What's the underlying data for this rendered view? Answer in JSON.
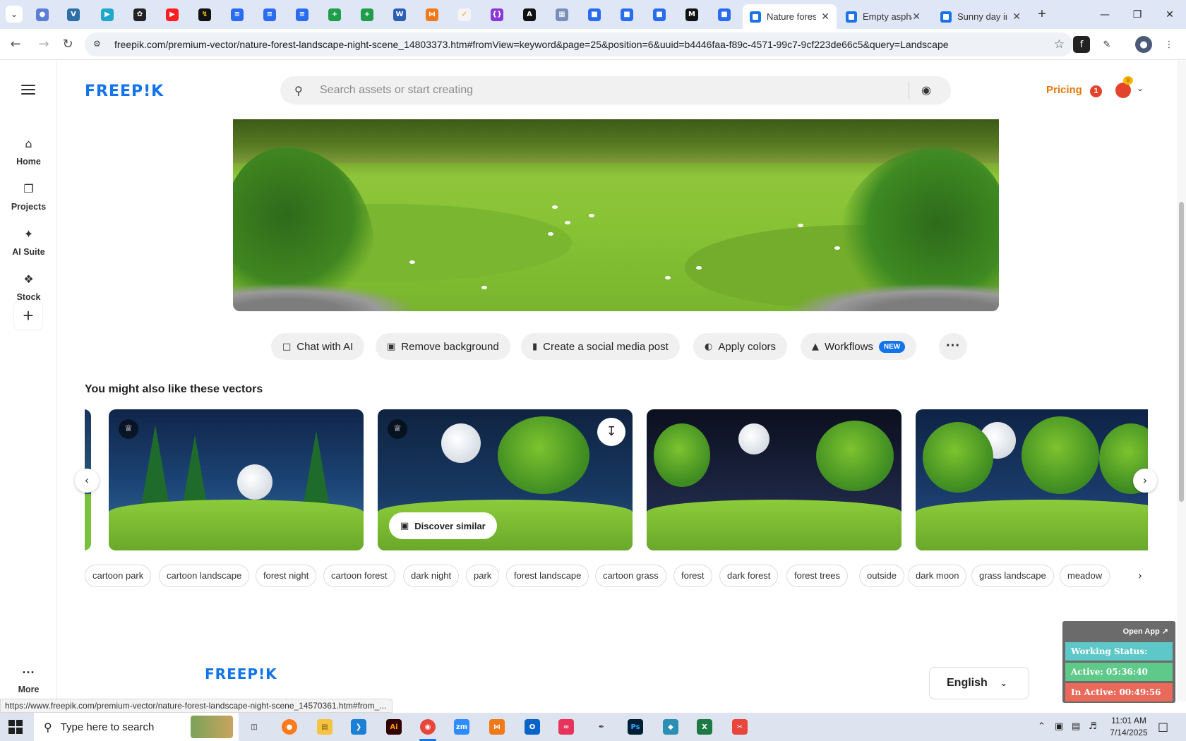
{
  "browser": {
    "tabs": [
      {
        "title": "Nature forest landscape night scene",
        "active": true
      },
      {
        "title": "Empty asphalt",
        "active": false
      },
      {
        "title": "Sunny day in",
        "active": false
      }
    ],
    "pinned_icons": [
      "chrome-icon",
      "vpn-icon",
      "arrow-icon",
      "openai-icon",
      "youtube-icon",
      "bolt-icon",
      "docs-icon",
      "docs-icon",
      "docs-icon",
      "sheets-icon",
      "sheets-icon",
      "word-icon",
      "xampp-icon",
      "bookmark-icon",
      "code-icon",
      "artstation-icon",
      "grid-icon",
      "forms-icon",
      "forms-icon",
      "forms-icon",
      "medium-icon",
      "forms-icon"
    ],
    "url": "freepik.com/premium-vector/nature-forest-landscape-night-scene_14803373.htm#fromView=keyword&page=25&position=6&uuid=b4446faa-f89c-4571-99c7-9cf223de66c5&query=Landscape",
    "status_url": "https://www.freepik.com/premium-vector/nature-forest-landscape-night-scene_14570361.htm#from_..."
  },
  "rail": {
    "items": [
      {
        "label": "Home",
        "icon": "home-icon"
      },
      {
        "label": "Projects",
        "icon": "projects-icon"
      },
      {
        "label": "AI Suite",
        "icon": "sparkle-icon"
      },
      {
        "label": "Stock",
        "icon": "stock-icon"
      }
    ],
    "more_label": "More"
  },
  "header": {
    "logo": "FREEP!K",
    "search_placeholder": "Search assets or start creating",
    "pricing": "Pricing",
    "notifications": "1"
  },
  "actions": [
    {
      "label": "Chat with AI",
      "icon": "chat-icon"
    },
    {
      "label": "Remove background",
      "icon": "remove-bg-icon"
    },
    {
      "label": "Create a social media post",
      "icon": "phone-icon"
    },
    {
      "label": "Apply colors",
      "icon": "palette-icon"
    },
    {
      "label": "Workflows",
      "icon": "workflow-icon",
      "badge": "NEW"
    }
  ],
  "related": {
    "title": "You might also like these vectors",
    "discover_label": "Discover similar"
  },
  "tags": [
    "cartoon park",
    "cartoon landscape",
    "forest night",
    "cartoon forest",
    "dark night",
    "park",
    "forest landscape",
    "cartoon grass",
    "forest",
    "dark forest",
    "forest trees",
    "outside",
    "dark moon",
    "grass landscape",
    "meadow"
  ],
  "footer": {
    "logo": "FREEP!K",
    "language": "English"
  },
  "tracker": {
    "open_app": "Open App ↗",
    "working_status": "Working Status: Active",
    "active": "Active: 05:36:40",
    "inactive": "In Active: 00:49:56"
  },
  "taskbar": {
    "search_placeholder": "Type here to search",
    "time": "11:01 AM",
    "date": "7/14/2025"
  },
  "colors": {
    "brand": "#1273eb",
    "pricing": "#e7760a",
    "new_badge": "#1273eb"
  }
}
